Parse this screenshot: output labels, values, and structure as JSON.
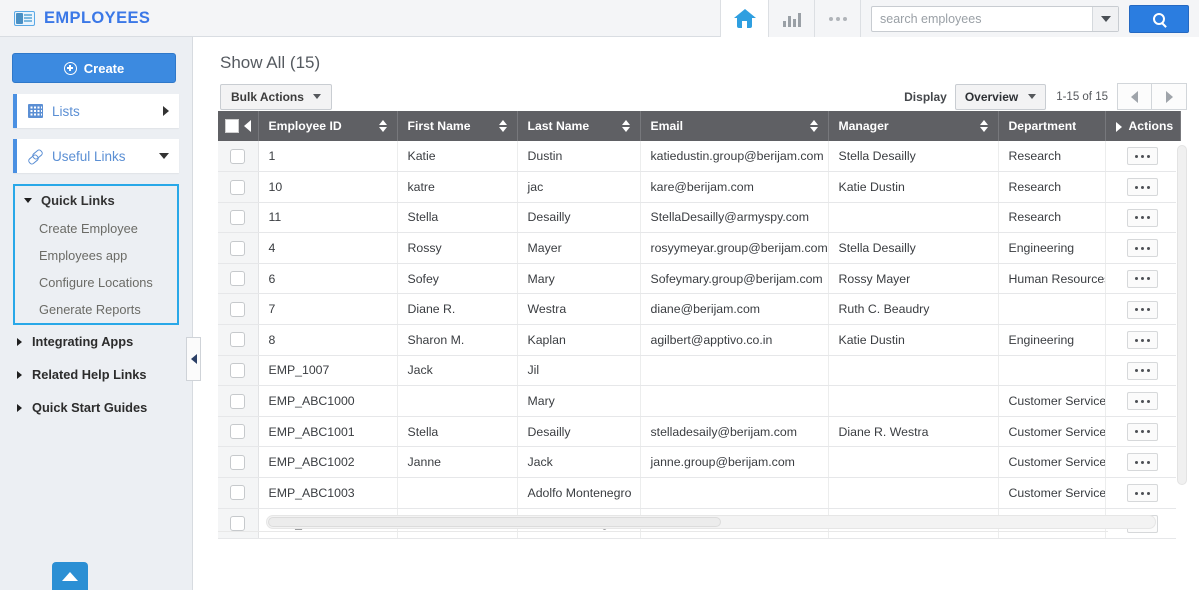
{
  "topbar": {
    "brand_title": "EMPLOYEES",
    "brand_icon": "id-card-icon",
    "home_icon": "home-icon",
    "reports_icon": "bar-chart-icon",
    "more_icon": "ellipsis-icon",
    "search_placeholder": "search employees",
    "search_value": "",
    "search_dropdown_icon": "chevron-down-icon",
    "search_button_icon": "search-icon"
  },
  "sidebar": {
    "create_label": "Create",
    "create_icon": "plus-circle-icon",
    "nav_cards": [
      {
        "label": "Lists",
        "icon": "grid-icon",
        "state_icon": "chevron-right-icon"
      },
      {
        "label": "Useful Links",
        "icon": "link-icon",
        "state_icon": "chevron-down-icon"
      }
    ],
    "quick_links": {
      "header": "Quick Links",
      "header_icon": "chevron-down-icon",
      "items": [
        "Create Employee",
        "Employees app",
        "Configure Locations",
        "Generate Reports"
      ]
    },
    "sections": [
      {
        "label": "Integrating Apps",
        "icon": "chevron-right-icon"
      },
      {
        "label": "Related Help Links",
        "icon": "chevron-right-icon"
      },
      {
        "label": "Quick Start Guides",
        "icon": "chevron-right-icon"
      }
    ],
    "scroll_top_icon": "chevron-up-icon",
    "collapse_icon": "chevron-left-icon"
  },
  "main": {
    "page_title": "Show All (15)",
    "bulk_actions_label": "Bulk Actions",
    "bulk_actions_icon": "caret-down-icon",
    "display_label": "Display",
    "display_value": "Overview",
    "display_icon": "caret-down-icon",
    "range_text": "1-15 of 15",
    "prev_icon": "chevron-left-icon",
    "next_icon": "chevron-right-icon"
  },
  "table": {
    "select_all_icon": "checkbox-icon",
    "header_collapse_icon": "chevron-left-icon",
    "actions_expand_icon": "chevron-right-icon",
    "sort_icon": "sort-updown-icon",
    "row_action_icon": "ellipsis-icon",
    "columns": [
      {
        "key": "employee_id",
        "label": "Employee ID",
        "sortable": true
      },
      {
        "key": "first_name",
        "label": "First Name",
        "sortable": true
      },
      {
        "key": "last_name",
        "label": "Last Name",
        "sortable": true
      },
      {
        "key": "email",
        "label": "Email",
        "sortable": true
      },
      {
        "key": "manager",
        "label": "Manager",
        "sortable": true
      },
      {
        "key": "department",
        "label": "Department",
        "sortable": false
      },
      {
        "key": "actions",
        "label": "Actions",
        "sortable": false
      }
    ],
    "rows": [
      {
        "employee_id": "1",
        "first_name": "Katie",
        "last_name": "Dustin",
        "email": "katiedustin.group@berijam.com",
        "manager": "Stella Desailly",
        "department": "Research"
      },
      {
        "employee_id": "10",
        "first_name": "katre",
        "last_name": "jac",
        "email": "kare@berijam.com",
        "manager": "Katie Dustin",
        "department": "Research"
      },
      {
        "employee_id": "11",
        "first_name": "Stella",
        "last_name": "Desailly",
        "email": "StellaDesailly@armyspy.com",
        "manager": "",
        "department": "Research"
      },
      {
        "employee_id": "4",
        "first_name": "Rossy",
        "last_name": "Mayer",
        "email": "rosyymeyar.group@berijam.com",
        "manager": "Stella Desailly",
        "department": "Engineering"
      },
      {
        "employee_id": "6",
        "first_name": "Sofey",
        "last_name": "Mary",
        "email": "Sofeymary.group@berijam.com",
        "manager": "Rossy Mayer",
        "department": "Human Resources"
      },
      {
        "employee_id": "7",
        "first_name": "Diane R.",
        "last_name": "Westra",
        "email": "diane@berijam.com",
        "manager": "Ruth C. Beaudry",
        "department": ""
      },
      {
        "employee_id": "8",
        "first_name": "Sharon M.",
        "last_name": "Kaplan",
        "email": "agilbert@apptivo.co.in",
        "manager": "Katie Dustin",
        "department": "Engineering"
      },
      {
        "employee_id": "EMP_1007",
        "first_name": "Jack",
        "last_name": "Jil",
        "email": "",
        "manager": "",
        "department": ""
      },
      {
        "employee_id": "EMP_ABC1000",
        "first_name": "",
        "last_name": "Mary",
        "email": "",
        "manager": "",
        "department": "Customer Service"
      },
      {
        "employee_id": "EMP_ABC1001",
        "first_name": "Stella",
        "last_name": "Desailly",
        "email": "stelladesaily@berijam.com",
        "manager": "Diane R. Westra",
        "department": "Customer Service"
      },
      {
        "employee_id": "EMP_ABC1002",
        "first_name": "Janne",
        "last_name": "Jack",
        "email": "janne.group@berijam.com",
        "manager": "",
        "department": "Customer Service"
      },
      {
        "employee_id": "EMP_ABC1003",
        "first_name": "",
        "last_name": "Adolfo Montenegro",
        "email": "",
        "manager": "",
        "department": "Customer Service"
      },
      {
        "employee_id": "EMP_ABC1004",
        "first_name": "",
        "last_name": "Lisa Montenegro - D...",
        "email": "",
        "manager": "",
        "department": "Customer Service"
      }
    ]
  },
  "colors": {
    "brand_blue": "#3b78e7",
    "accent_blue": "#2b7de0",
    "header_gray": "#5f6064",
    "sidebar_bg": "#eceff3",
    "quick_links_border": "#29a8e8"
  }
}
